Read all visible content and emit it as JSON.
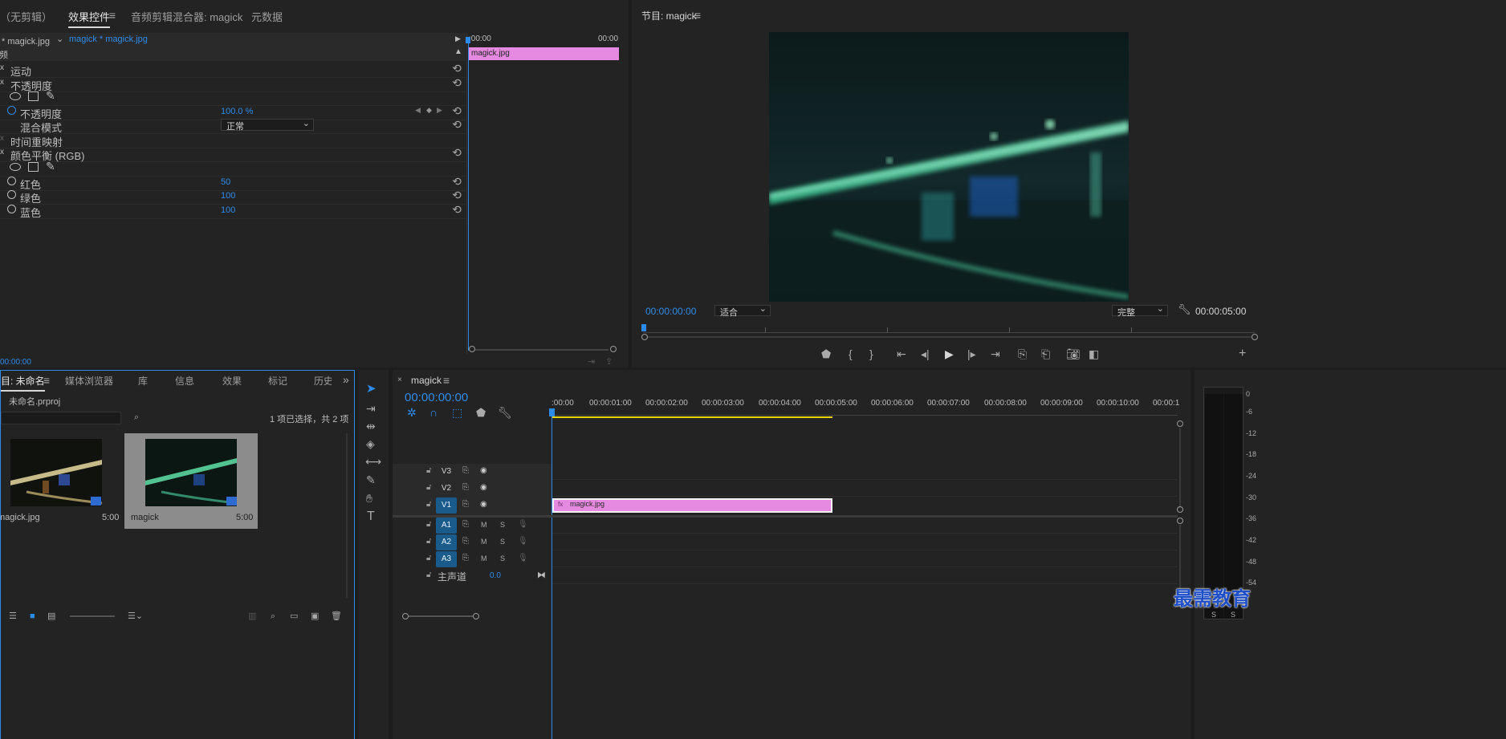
{
  "effect_panel": {
    "tabs": [
      "（无剪辑）",
      "效果控件",
      "音频剪辑混合器: magick",
      "元数据"
    ],
    "source_label": "源 * magick.jpg",
    "clip_label": "magick * magick.jpg",
    "ruler_start": ":00:00",
    "ruler_end": "00:00",
    "clip_name": "magick.jpg",
    "section_video": "视频",
    "effects": {
      "motion": "运动",
      "opacity": "不透明度",
      "opacity_prop": "不透明度",
      "opacity_value": "100.0 %",
      "blend_mode_label": "混合模式",
      "blend_mode_value": "正常",
      "time_remap": "时间重映射",
      "color_balance": "颜色平衡 (RGB)",
      "red_label": "红色",
      "red_value": "50",
      "green_label": "绿色",
      "green_value": "100",
      "blue_label": "蓝色",
      "blue_value": "100"
    },
    "footer_time": "00:00:00"
  },
  "program_monitor": {
    "title": "节目: magick",
    "current_time": "00:00:00:00",
    "fit_value": "适合",
    "quality_value": "完整",
    "duration": "00:00:05:00"
  },
  "project_panel": {
    "tabs": [
      "项目: 未命名",
      "媒体浏览器",
      "库",
      "信息",
      "效果",
      "标记",
      "历史"
    ],
    "project_file": "未命名.prproj",
    "selection_info": "1 项已选择，共 2 项",
    "items": [
      {
        "name": "magick.jpg",
        "duration": "5:00"
      },
      {
        "name": "magick",
        "duration": "5:00"
      }
    ]
  },
  "timeline": {
    "sequence_name": "magick",
    "current_time": "00:00:00:00",
    "ruler_labels": [
      ":00:00",
      "00:00:01:00",
      "00:00:02:00",
      "00:00:03:00",
      "00:00:04:00",
      "00:00:05:00",
      "00:00:06:00",
      "00:00:07:00",
      "00:00:08:00",
      "00:00:09:00",
      "00:00:10:00",
      "00:00:1"
    ],
    "video_tracks": [
      "V3",
      "V2",
      "V1"
    ],
    "audio_tracks": [
      "A1",
      "A2",
      "A3"
    ],
    "track_m": "M",
    "track_s": "S",
    "master_label": "主声道",
    "master_value": "0.0",
    "clip_name": "magick.jpg",
    "fx_badge": "fx"
  },
  "audio_meter": {
    "scale": [
      "0",
      "-6",
      "-12",
      "-18",
      "-24",
      "-30",
      "-36",
      "-42",
      "-48",
      "-54"
    ],
    "solo_labels": [
      "S",
      "S"
    ]
  },
  "watermark": "最需教育",
  "colors": {
    "accent_blue": "#2d8ceb",
    "clip_pink": "#e58ae0",
    "track_active": "#1a5b8c",
    "work_area": "#e8d300"
  }
}
